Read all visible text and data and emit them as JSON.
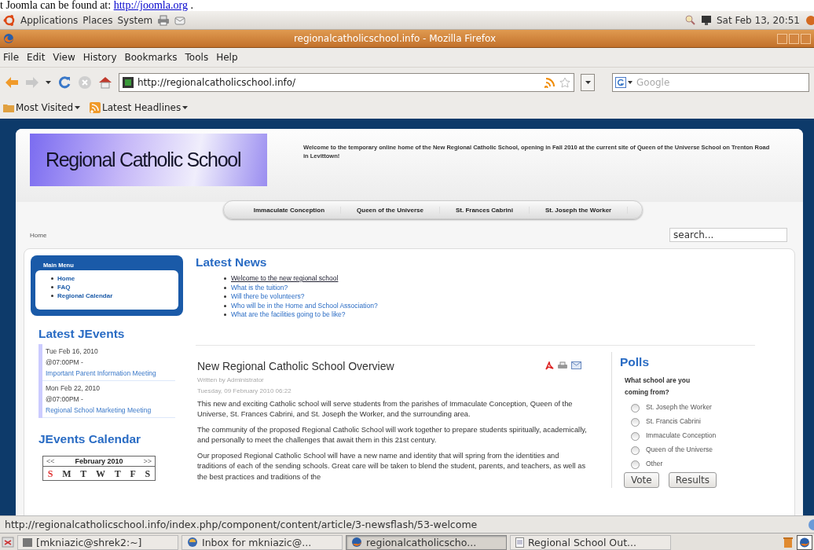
{
  "document_line": {
    "text": "t Joomla can be found at: ",
    "link": "http://joomla.org",
    "after": " ."
  },
  "top_panel": {
    "menus": [
      "Applications",
      "Places",
      "System"
    ],
    "clock": "Sat Feb 13, 20:51"
  },
  "window": {
    "title": "regionalcatholicschool.info - Mozilla Firefox"
  },
  "menu_bar": [
    "File",
    "Edit",
    "View",
    "History",
    "Bookmarks",
    "Tools",
    "Help"
  ],
  "address_bar": {
    "value": "http://regionalcatholicschool.info/"
  },
  "search_bar": {
    "placeholder": "Google"
  },
  "bookmarks": [
    "Most Visited",
    "Latest Headlines"
  ],
  "site": {
    "logo": "Regional Catholic School",
    "welcome": "Welcome to the temporary online home of the New Regional Catholic School, opening in Fall 2010 at the current site of Queen of the Universe School on Trenton Road in Levittown!",
    "nav": [
      "Immaculate Conception",
      "Queen of the Universe",
      "St. Frances Cabrini",
      "St. Joseph the Worker"
    ],
    "breadcrumb": "Home",
    "search": {
      "value": "search..."
    },
    "main_menu": {
      "title": "Main Menu",
      "items": [
        "Home",
        "FAQ",
        "Regional Calendar"
      ]
    },
    "latest_events": {
      "title": "Latest JEvents",
      "events": [
        {
          "date": "Tue Feb 16, 2010",
          "time": "@07:00PM -",
          "title": "Important Parent Information Meeting"
        },
        {
          "date": "Mon Feb 22, 2010",
          "time": "@07:00PM -",
          "title": "Regional School Marketing Meeting"
        }
      ]
    },
    "calendar": {
      "title": "JEvents Calendar",
      "prev": "<<",
      "month": "February 2010",
      "next": ">>",
      "days": [
        {
          "label": "S",
          "color": "#e03030"
        },
        {
          "label": "M",
          "color": "#333333"
        },
        {
          "label": "T",
          "color": "#333333"
        },
        {
          "label": "W",
          "color": "#333333"
        },
        {
          "label": "T",
          "color": "#333333"
        },
        {
          "label": "F",
          "color": "#333333"
        },
        {
          "label": "S",
          "color": "#333333"
        }
      ]
    },
    "latest_news": {
      "title": "Latest News",
      "items": [
        {
          "text": "Welcome to the new regional school",
          "hovered": true
        },
        {
          "text": "What is the tuition?",
          "hovered": false
        },
        {
          "text": "Will there be volunteers?",
          "hovered": false
        },
        {
          "text": "Who will be in the Home and School Association?",
          "hovered": false
        },
        {
          "text": "What are the facilities going to be like?",
          "hovered": false
        }
      ]
    },
    "article": {
      "title": "New Regional Catholic School Overview",
      "author": "Written by Administrator",
      "date": "Tuesday, 09 February 2010 06:22",
      "paragraphs": [
        "This new and exciting Catholic school will serve students from the parishes of Immaculate Conception, Queen of the Universe, St. Frances Cabrini, and St. Joseph the Worker, and the surrounding area.",
        "The community of the proposed Regional Catholic School will work together to prepare students spiritually, academically, and personally to meet the challenges that await them in this 21st century.",
        "Our proposed Regional Catholic School will have a new name and identity that will spring from the identities and traditions of each of the sending schools. Great care will be taken to blend the student, parents, and teachers, as well as the best practices and traditions of the"
      ]
    },
    "poll": {
      "title": "Polls",
      "question": "What school are you coming from?",
      "options": [
        {
          "label": "St. Joseph the Worker",
          "selected": false
        },
        {
          "label": "St. Francis Cabrini",
          "selected": false
        },
        {
          "label": "Immaculate Conception",
          "selected": false
        },
        {
          "label": "Queen of the Universe",
          "selected": false
        },
        {
          "label": "Other",
          "selected": false
        }
      ],
      "buttons": [
        "Vote",
        "Results"
      ]
    }
  },
  "status_bar": {
    "text": "http://regionalcatholicschool.info/index.php/component/content/article/3-newsflash/53-welcome"
  },
  "taskbar": {
    "items": [
      {
        "label": "[mkniazic@shrek2:~]",
        "kind": "terminal",
        "selected": false
      },
      {
        "label": "Inbox for mkniazic@...",
        "kind": "mail",
        "selected": false
      },
      {
        "label": "regionalcatholicscho...",
        "kind": "browser",
        "selected": true
      },
      {
        "label": "Regional School Out...",
        "kind": "document",
        "selected": false
      }
    ]
  }
}
